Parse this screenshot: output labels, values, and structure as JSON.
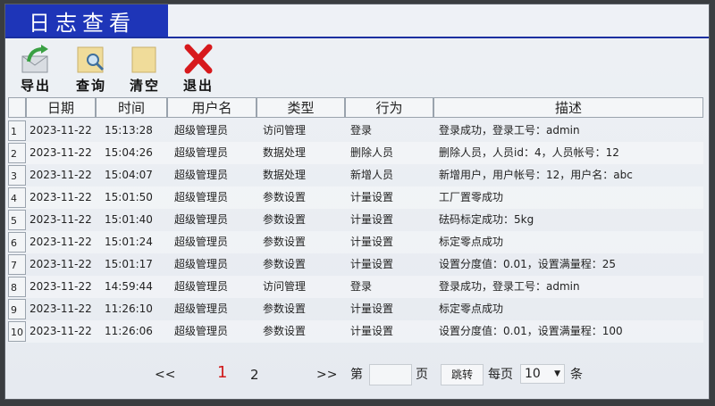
{
  "window": {
    "title": "日志查看"
  },
  "toolbar": [
    {
      "label": "导出",
      "icon": "export-icon"
    },
    {
      "label": "查询",
      "icon": "search-folder-icon"
    },
    {
      "label": "清空",
      "icon": "clear-folder-icon"
    },
    {
      "label": "退出",
      "icon": "exit-icon"
    }
  ],
  "table": {
    "headers": [
      "日期",
      "时间",
      "用户名",
      "类型",
      "行为",
      "描述"
    ],
    "rows": [
      {
        "idx": "1",
        "date": "2023-11-22",
        "time": "15:13:28",
        "user": "超级管理员",
        "type": "访问管理",
        "action": "登录",
        "desc": "登录成功，登录工号：admin"
      },
      {
        "idx": "2",
        "date": "2023-11-22",
        "time": "15:04:26",
        "user": "超级管理员",
        "type": "数据处理",
        "action": "删除人员",
        "desc": "删除人员，人员id：4，人员帐号：12"
      },
      {
        "idx": "3",
        "date": "2023-11-22",
        "time": "15:04:07",
        "user": "超级管理员",
        "type": "数据处理",
        "action": "新增人员",
        "desc": "新增用户，用户帐号：12，用户名：abc"
      },
      {
        "idx": "4",
        "date": "2023-11-22",
        "time": "15:01:50",
        "user": "超级管理员",
        "type": "参数设置",
        "action": "计量设置",
        "desc": "工厂置零成功"
      },
      {
        "idx": "5",
        "date": "2023-11-22",
        "time": "15:01:40",
        "user": "超级管理员",
        "type": "参数设置",
        "action": "计量设置",
        "desc": "砝码标定成功：5kg"
      },
      {
        "idx": "6",
        "date": "2023-11-22",
        "time": "15:01:24",
        "user": "超级管理员",
        "type": "参数设置",
        "action": "计量设置",
        "desc": "标定零点成功"
      },
      {
        "idx": "7",
        "date": "2023-11-22",
        "time": "15:01:17",
        "user": "超级管理员",
        "type": "参数设置",
        "action": "计量设置",
        "desc": "设置分度值：0.01，设置满量程：25"
      },
      {
        "idx": "8",
        "date": "2023-11-22",
        "time": "14:59:44",
        "user": "超级管理员",
        "type": "访问管理",
        "action": "登录",
        "desc": "登录成功，登录工号：admin"
      },
      {
        "idx": "9",
        "date": "2023-11-22",
        "time": "11:26:10",
        "user": "超级管理员",
        "type": "参数设置",
        "action": "计量设置",
        "desc": "标定零点成功"
      },
      {
        "idx": "10",
        "date": "2023-11-22",
        "time": "11:26:06",
        "user": "超级管理员",
        "type": "参数设置",
        "action": "计量设置",
        "desc": "设置分度值：0.01，设置满量程：100"
      }
    ]
  },
  "pager": {
    "prev": "<<",
    "page1": "1",
    "page2": "2",
    "next": ">>",
    "goto_prefix": "第",
    "goto_value": "",
    "goto_suffix": "页",
    "jump_label": "跳转",
    "per_page_label": "每页",
    "per_page_value": "10",
    "per_page_unit": "条",
    "current_page_color": "#d0191a"
  }
}
